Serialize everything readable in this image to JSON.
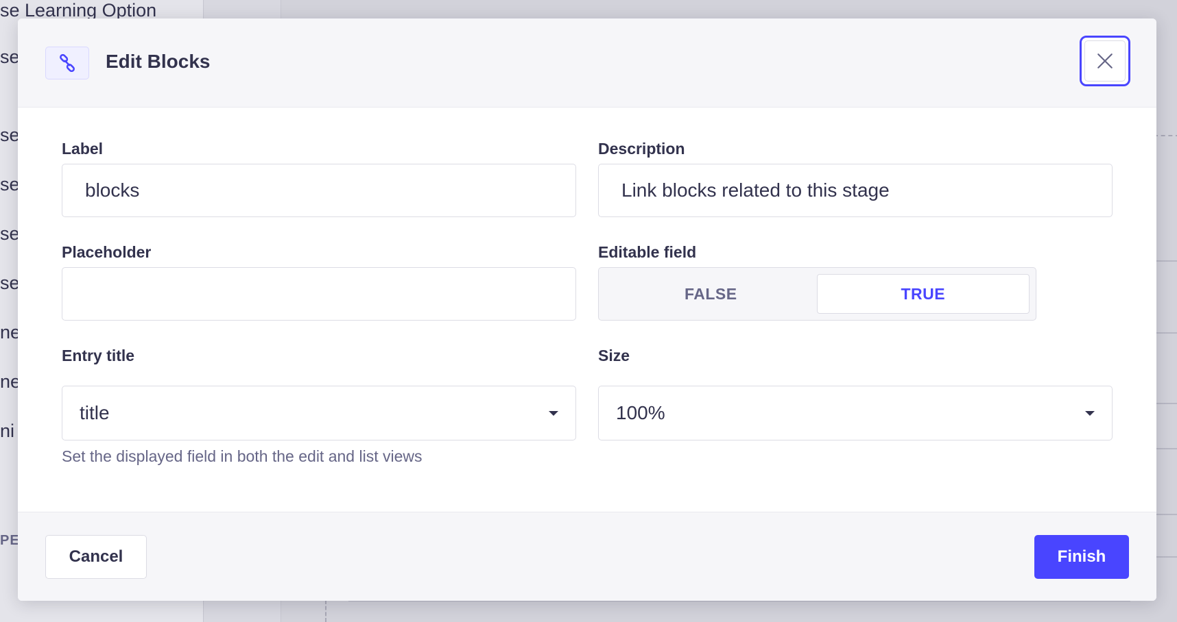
{
  "background": {
    "sidebar_items": [
      "se Learning Option",
      "se",
      "se",
      "se",
      "se",
      "se",
      "ne",
      "ne",
      "ni"
    ],
    "sidebar_section": "PE"
  },
  "modal": {
    "title": "Edit Blocks",
    "header_icon": "link-icon",
    "close_icon": "close-icon",
    "fields": {
      "label": {
        "label": "Label",
        "value": "blocks"
      },
      "description": {
        "label": "Description",
        "value": "Link blocks related to this stage"
      },
      "placeholder": {
        "label": "Placeholder",
        "value": ""
      },
      "editable": {
        "label": "Editable field",
        "options": [
          "FALSE",
          "TRUE"
        ],
        "selected": "TRUE"
      },
      "entry_title": {
        "label": "Entry title",
        "value": "title",
        "hint": "Set the displayed field in both the edit and list views"
      },
      "size": {
        "label": "Size",
        "value": "100%"
      }
    },
    "footer": {
      "cancel_label": "Cancel",
      "finish_label": "Finish"
    }
  },
  "colors": {
    "primary": "#4945ff",
    "text": "#32324d",
    "muted": "#666687",
    "border": "#dcdce4",
    "header_bg": "#f6f6f9"
  }
}
